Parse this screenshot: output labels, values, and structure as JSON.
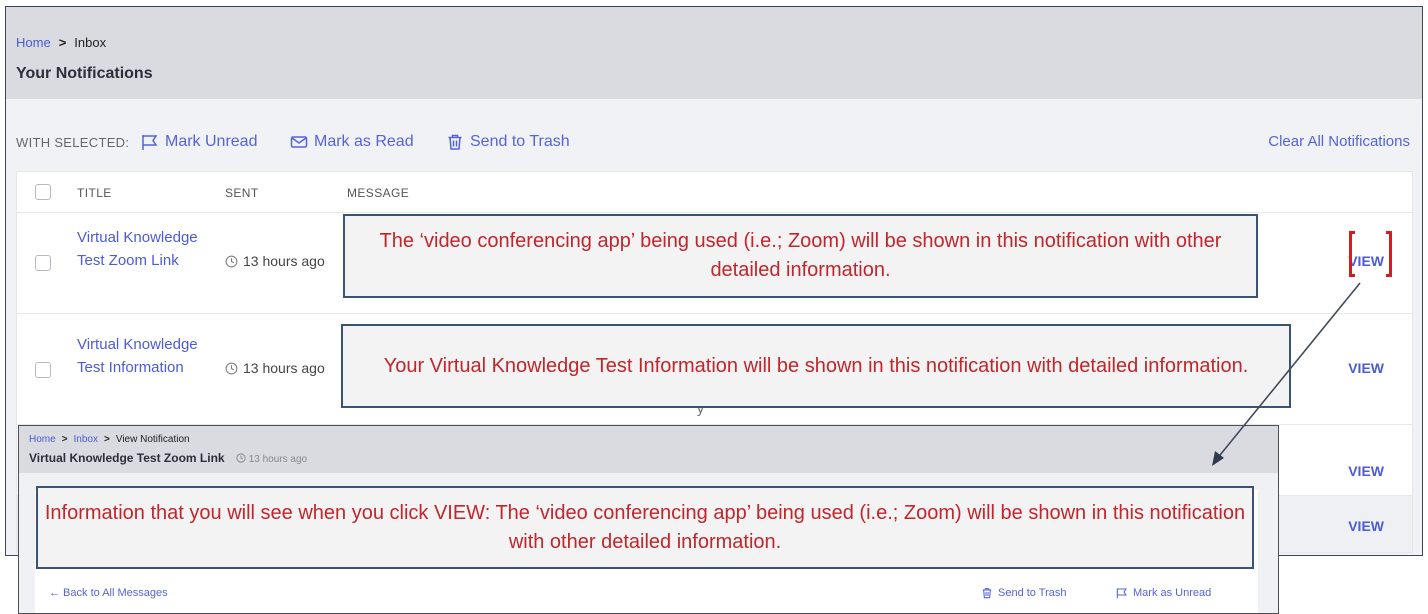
{
  "breadcrumb": {
    "home": "Home",
    "sep": ">",
    "current": "Inbox"
  },
  "page_title": "Your Notifications",
  "toolbar": {
    "with_selected": "WITH SELECTED:",
    "mark_unread": "Mark Unread",
    "mark_read": "Mark as Read",
    "send_trash": "Send to Trash",
    "clear_all": "Clear All Notifications"
  },
  "table": {
    "columns": [
      "TITLE",
      "SENT",
      "MESSAGE"
    ],
    "rows": [
      {
        "title": "Virtual Knowledge Test Zoom Link",
        "sent": "13 hours ago",
        "view": "VIEW"
      },
      {
        "title": "Virtual Knowledge Test Information",
        "sent": "13 hours ago",
        "message_partial": "y",
        "view": "VIEW"
      },
      {
        "view": "VIEW"
      },
      {
        "view": "VIEW"
      }
    ]
  },
  "callouts": {
    "zoom": "The ‘video conferencing app’ being used (i.e.; Zoom) will be shown in this notification with other detailed information.",
    "info": "Your Virtual Knowledge Test Information will be shown in this notification with detailed information.",
    "view": "Information that you will see when you click VIEW:  The ‘video conferencing app’ being used (i.e.; Zoom) will be shown in this notification with other detailed information."
  },
  "inset": {
    "breadcrumb": {
      "home": "Home",
      "sep": ">",
      "inbox": "Inbox",
      "current": "View Notification"
    },
    "title": "Virtual Knowledge Test Zoom Link",
    "time": "13 hours ago",
    "back": "← Back to All Messages",
    "send_trash": "Send to Trash",
    "mark_unread": "Mark as Unread"
  },
  "colors": {
    "link": "#4a5cd6",
    "callout_text": "#c0262c",
    "callout_border": "#3a5377",
    "bracket": "#d11f1f"
  },
  "icons": [
    "flag-icon",
    "envelope-icon",
    "trash-icon",
    "clock-icon",
    "arrow-left-icon"
  ]
}
